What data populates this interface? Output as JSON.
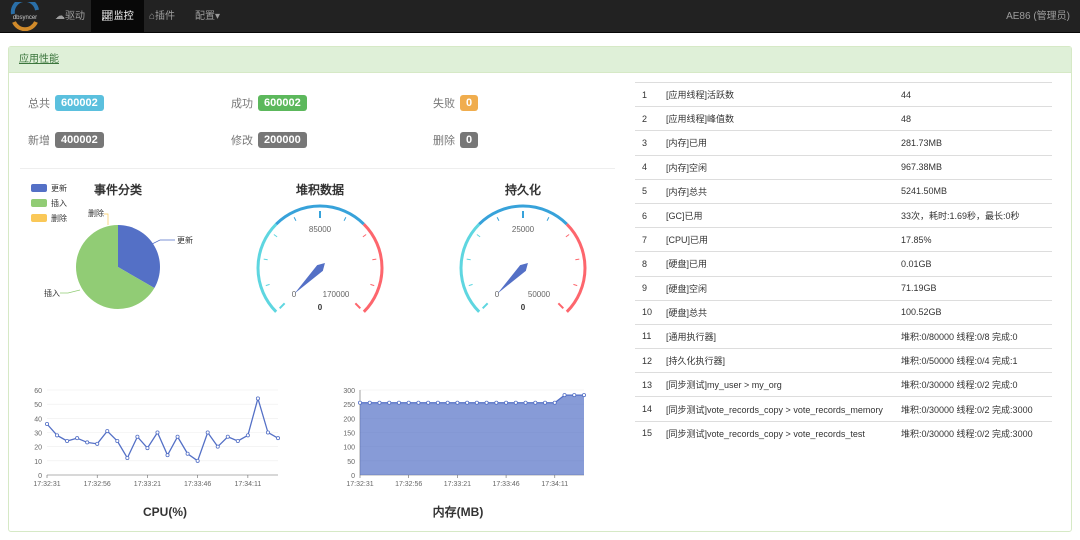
{
  "nav": {
    "logo_text": "dbsyncer",
    "items": [
      {
        "label": "驱动",
        "icon": "cloud-icon"
      },
      {
        "label": "监控",
        "icon": "line-chart-icon",
        "active": true
      },
      {
        "label": "插件",
        "icon": "plugin-icon"
      },
      {
        "label": "配置",
        "icon": "caret-down-icon"
      }
    ],
    "user": "AE86 (管理员)"
  },
  "panel": {
    "title": "应用性能"
  },
  "stats": [
    {
      "label": "总共",
      "value": "600002",
      "color": "#5bc0de"
    },
    {
      "label": "成功",
      "value": "600002",
      "color": "#5cb85c"
    },
    {
      "label": "失败",
      "value": "0",
      "color": "#f0ad4e"
    },
    {
      "label": "新增",
      "value": "400002",
      "color": "#777777"
    },
    {
      "label": "修改",
      "value": "200000",
      "color": "#777777"
    },
    {
      "label": "删除",
      "value": "0",
      "color": "#777777"
    }
  ],
  "chart_data": [
    {
      "type": "pie",
      "title": "事件分类",
      "legend": [
        "更新",
        "插入",
        "删除"
      ],
      "legend_placement": "top-left",
      "colors": [
        "#5470c6",
        "#91cc75",
        "#fac858"
      ],
      "values": [
        200000,
        400002,
        0
      ]
    },
    {
      "type": "gauge",
      "title": "堆积数据",
      "min": 0,
      "max": 170000,
      "mid_label": "85000",
      "min_label": "0",
      "max_label": "170000",
      "value": 0,
      "value_label": "0"
    },
    {
      "type": "gauge",
      "title": "持久化",
      "min": 0,
      "max": 50000,
      "mid_label": "25000",
      "min_label": "0",
      "max_label": "50000",
      "value": 0,
      "value_label": "0"
    },
    {
      "type": "line",
      "title": "CPU(%)",
      "ylim": [
        0,
        60
      ],
      "yticks": [
        "0",
        "10",
        "20",
        "30",
        "40",
        "50",
        "60"
      ],
      "xticks": [
        "17:32:31",
        "17:32:56",
        "17:33:21",
        "17:33:46",
        "17:34:11"
      ],
      "color": "#5470c6",
      "values": [
        36,
        28,
        24,
        26,
        23,
        22,
        31,
        24,
        12,
        27,
        19,
        30,
        14,
        27,
        15,
        10,
        30,
        20,
        27,
        24,
        28,
        54,
        30,
        26
      ]
    },
    {
      "type": "area",
      "title": "内存(MB)",
      "ylim": [
        0,
        300
      ],
      "yticks": [
        "0",
        "50",
        "100",
        "150",
        "200",
        "250",
        "300"
      ],
      "xticks": [
        "17:32:31",
        "17:32:56",
        "17:33:21",
        "17:33:46",
        "17:34:11"
      ],
      "color": "#5470c6",
      "values": [
        255,
        255,
        255,
        255,
        255,
        255,
        255,
        255,
        255,
        255,
        255,
        255,
        255,
        255,
        255,
        255,
        255,
        255,
        255,
        255,
        255,
        282,
        282,
        282
      ]
    }
  ],
  "metrics": [
    [
      "1",
      "[应用线程]活跃数",
      "44"
    ],
    [
      "2",
      "[应用线程]峰值数",
      "48"
    ],
    [
      "3",
      "[内存]已用",
      "281.73MB"
    ],
    [
      "4",
      "[内存]空闲",
      "967.38MB"
    ],
    [
      "5",
      "[内存]总共",
      "5241.50MB"
    ],
    [
      "6",
      "[GC]已用",
      "33次，耗时:1.69秒，最长:0秒"
    ],
    [
      "7",
      "[CPU]已用",
      "17.85%"
    ],
    [
      "8",
      "[硬盘]已用",
      "0.01GB"
    ],
    [
      "9",
      "[硬盘]空闲",
      "71.19GB"
    ],
    [
      "10",
      "[硬盘]总共",
      "100.52GB"
    ],
    [
      "11",
      "[通用执行器]",
      "堆积:0/80000 线程:0/8 完成:0"
    ],
    [
      "12",
      "[持久化执行器]",
      "堆积:0/50000 线程:0/4 完成:1"
    ],
    [
      "13",
      "[同步测试]my_user > my_org",
      "堆积:0/30000 线程:0/2 完成:0"
    ],
    [
      "14",
      "[同步测试]vote_records_copy > vote_records_memory",
      "堆积:0/30000 线程:0/2 完成:3000"
    ],
    [
      "15",
      "[同步测试]vote_records_copy > vote_records_test",
      "堆积:0/30000 线程:0/2 完成:3000"
    ]
  ]
}
